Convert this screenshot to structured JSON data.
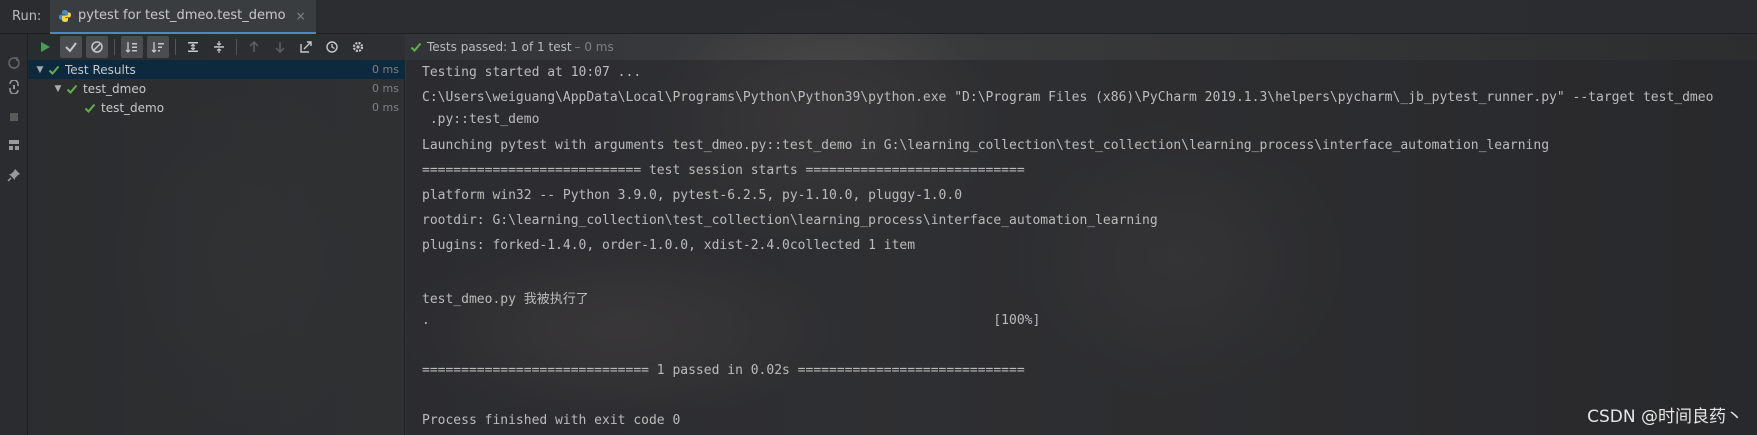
{
  "run": {
    "label": "Run:",
    "tab_title": "pytest for test_dmeo.test_demo",
    "close_glyph": "×"
  },
  "status": {
    "passed_text": "Tests passed:",
    "count_text": "1 of 1 test",
    "time_text": "– 0 ms"
  },
  "tree": {
    "root": {
      "label": "Test Results",
      "time": "0 ms"
    },
    "module": {
      "label": "test_dmeo",
      "time": "0 ms"
    },
    "test": {
      "label": "test_demo",
      "time": "0 ms"
    }
  },
  "console": {
    "lines": [
      "Testing started at 10:07 ...",
      "C:\\Users\\weiguang\\AppData\\Local\\Programs\\Python\\Python39\\python.exe \"D:\\Program Files (x86)\\PyCharm 2019.1.3\\helpers\\pycharm\\_jb_pytest_runner.py\" --target test_dmeo",
      " .py::test_demo",
      "Launching pytest with arguments test_dmeo.py::test_demo in G:\\learning_collection\\test_collection\\learning_process\\interface_automation_learning",
      "============================ test session starts ============================",
      "platform win32 -- Python 3.9.0, pytest-6.2.5, py-1.10.0, pluggy-1.0.0",
      "rootdir: G:\\learning_collection\\test_collection\\learning_process\\interface_automation_learning",
      "plugins: forked-1.4.0, order-1.0.0, xdist-2.4.0collected 1 item",
      "",
      "test_dmeo.py 我被执行了",
      ".                                                                        [100%]",
      "",
      "============================= 1 passed in 0.02s =============================",
      "",
      "Process finished with exit code 0"
    ]
  },
  "watermark": "CSDN @时间良药丶",
  "colors": {
    "pass_green": "#5fb04c",
    "run_green": "#499c54",
    "selection": "#0d293e",
    "accent": "#4a88c7"
  },
  "icons": {
    "toolbar": [
      "run-icon",
      "show-passed-icon",
      "show-ignored-icon",
      "sort-alpha-icon",
      "sort-duration-icon",
      "expand-all-icon",
      "collapse-all-icon",
      "prev-failed-icon",
      "next-failed-icon",
      "export-icon",
      "history-icon",
      "settings-icon"
    ],
    "leftbar": [
      "rerun-failed-icon",
      "toggle-auto-test-icon",
      "stop-icon",
      "layout-icon",
      "pin-icon"
    ]
  }
}
